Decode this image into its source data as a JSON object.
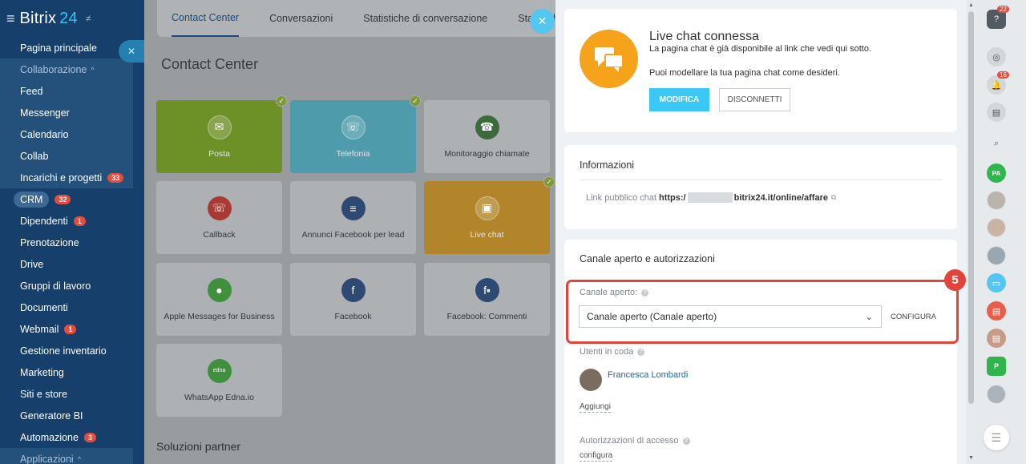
{
  "app": {
    "name": "Bitrix",
    "version": "24"
  },
  "sidebar": {
    "items": [
      {
        "label": "Pagina principale"
      },
      {
        "label": "Collaborazione",
        "expanded": true
      },
      {
        "label": "Feed"
      },
      {
        "label": "Messenger"
      },
      {
        "label": "Calendario"
      },
      {
        "label": "Collab"
      },
      {
        "label": "Incarichi e progetti",
        "badge": "33"
      },
      {
        "label": "CRM",
        "badge": "32"
      },
      {
        "label": "Dipendenti",
        "badge": "1"
      },
      {
        "label": "Prenotazione"
      },
      {
        "label": "Drive"
      },
      {
        "label": "Gruppi di lavoro"
      },
      {
        "label": "Documenti"
      },
      {
        "label": "Webmail",
        "badge": "1"
      },
      {
        "label": "Gestione inventario"
      },
      {
        "label": "Marketing"
      },
      {
        "label": "Siti e store"
      },
      {
        "label": "Generatore BI"
      },
      {
        "label": "Automazione",
        "badge": "3"
      },
      {
        "label": "Applicazioni"
      }
    ]
  },
  "tabs": [
    "Contact Center",
    "Conversazioni",
    "Statistiche di conversazione",
    "Statistich"
  ],
  "contact_center": {
    "title": "Contact Center",
    "tiles": [
      {
        "label": "Posta",
        "connected": true
      },
      {
        "label": "Telefonia",
        "connected": true
      },
      {
        "label": "Monitoraggio chiamate"
      },
      {
        "label": "Callback"
      },
      {
        "label": "Annunci Facebook per lead"
      },
      {
        "label": "Live chat",
        "connected": true
      },
      {
        "label": "Apple Messages for Business"
      },
      {
        "label": "Facebook"
      },
      {
        "label": "Facebook: Commenti"
      },
      {
        "label": "WhatsApp Edna.io",
        "icon_text": "edna"
      }
    ],
    "partner_title": "Soluzioni partner"
  },
  "panel": {
    "status_title": "Live chat connessa",
    "status_line1": "La pagina chat è già disponibile al link che vedi qui sotto.",
    "status_line2": "Puoi modellare la tua pagina chat come desideri.",
    "edit_button": "MODIFICA",
    "disconnect_button": "DISCONNETTI",
    "info_title": "Informazioni",
    "public_link_label": "Link pubblico chat",
    "public_link_start": "https:/",
    "public_link_end": "bitrix24.it/online/affare",
    "channel_section_title": "Canale aperto e autorizzazioni",
    "channel_label": "Canale aperto:",
    "channel_value": "Canale aperto (Canale aperto)",
    "configure_button": "CONFIGURA",
    "queue_label": "Utenti in coda",
    "queue_user": "Francesca Lombardi",
    "add_link": "Aggiungi",
    "access_label": "Autorizzazioni di accesso",
    "access_link": "configura",
    "step_number": "5"
  },
  "right_bar": {
    "help_badge": "22",
    "notifications_badge": "16",
    "avatars": [
      "PA",
      "P"
    ]
  }
}
